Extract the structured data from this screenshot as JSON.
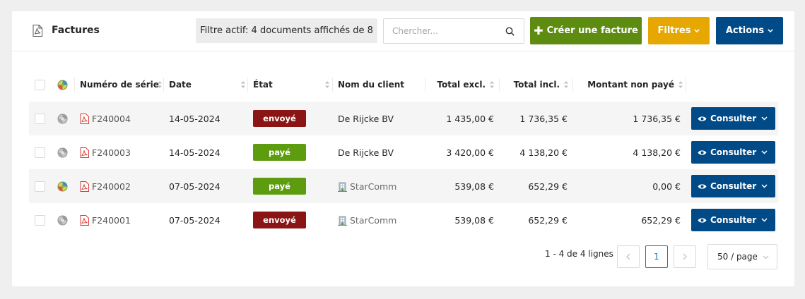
{
  "header": {
    "title": "Factures",
    "filter_info": "Filtre actif: 4 documents affichés de 8",
    "search_placeholder": "Chercher...",
    "create_label": "Créer une facture",
    "filters_label": "Filtres",
    "actions_label": "Actions"
  },
  "columns": {
    "series": "Numéro de série",
    "date": "Date",
    "state": "État",
    "client": "Nom du client",
    "total_excl": "Total excl.",
    "total_incl": "Total incl.",
    "unpaid": "Montant non payé"
  },
  "rows": [
    {
      "series": "F240004",
      "date": "14-05-2024",
      "state": "envoyé",
      "state_color": "#8b1414",
      "client": "De Rijcke BV",
      "client_icon": false,
      "status_icon": "grey",
      "total_excl": "1 435,00 €",
      "total_incl": "1 736,35 €",
      "unpaid": "1 736,35 €",
      "action": "Consulter"
    },
    {
      "series": "F240003",
      "date": "14-05-2024",
      "state": "payé",
      "state_color": "#5d9c0e",
      "client": "De Rijcke BV",
      "client_icon": false,
      "status_icon": "grey",
      "total_excl": "3 420,00 €",
      "total_incl": "4 138,20 €",
      "unpaid": "4 138,20 €",
      "action": "Consulter"
    },
    {
      "series": "F240002",
      "date": "07-05-2024",
      "state": "payé",
      "state_color": "#5d9c0e",
      "client": "StarComm",
      "client_icon": true,
      "status_icon": "color",
      "total_excl": "539,08 €",
      "total_incl": "652,29 €",
      "unpaid": "0,00 €",
      "action": "Consulter"
    },
    {
      "series": "F240001",
      "date": "07-05-2024",
      "state": "envoyé",
      "state_color": "#8b1414",
      "client": "StarComm",
      "client_icon": true,
      "status_icon": "grey",
      "total_excl": "539,08 €",
      "total_incl": "652,29 €",
      "unpaid": "652,29 €",
      "action": "Consulter"
    }
  ],
  "pagination": {
    "summary": "1 - 4 de 4 lignes",
    "current_page": "1",
    "page_size": "50 / page"
  },
  "colors": {
    "create": "#5d8c10",
    "filters": "#e6a800",
    "actions": "#004a87",
    "sent": "#8b1414",
    "paid": "#5d9c0e"
  }
}
